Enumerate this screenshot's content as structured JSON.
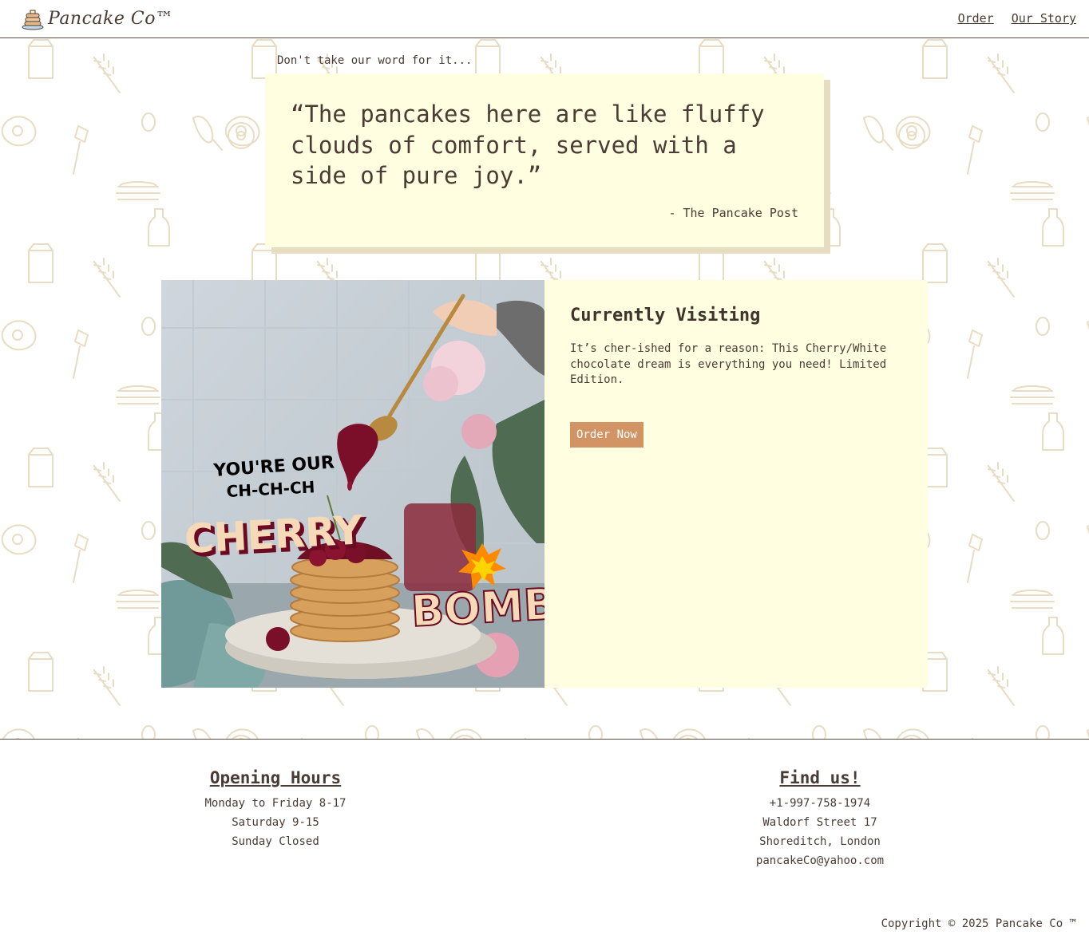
{
  "header": {
    "brand": "Pancake Co™",
    "nav": [
      {
        "label": "Order"
      },
      {
        "label": "Our Story"
      }
    ]
  },
  "testimonial": {
    "intro": "Don't take our word for it...",
    "quote": "“The pancakes here are like fluffy clouds of comfort, served with a side of pure joy.”",
    "source": "- The Pancake Post"
  },
  "feature": {
    "image_text": {
      "line1": "YOU'RE OUR",
      "line2": "CH-CH-CH",
      "word1": "CHERRY",
      "word2": "BOMB!"
    },
    "title": "Currently Visiting",
    "description": "It’s cher-ished for a reason: This Cherry/White chocolate dream is everything you need! Limited Edition.",
    "button": "Order Now"
  },
  "footer": {
    "hours": {
      "title": "Opening Hours",
      "lines": [
        "Monday to Friday 8-17",
        "Saturday 9-15",
        "Sunday Closed"
      ]
    },
    "find": {
      "title": "Find us!",
      "lines": [
        "+1-997-758-1974",
        "Waldorf Street 17",
        "Shoreditch, London",
        "pancakeCo@yahoo.com"
      ]
    },
    "copyright": "Copyright © 2025 Pancake Co ™"
  },
  "colors": {
    "cream": "#fffee0",
    "button": "#d29464",
    "text": "#4a3c34",
    "doodle": "#e8dcc2"
  }
}
